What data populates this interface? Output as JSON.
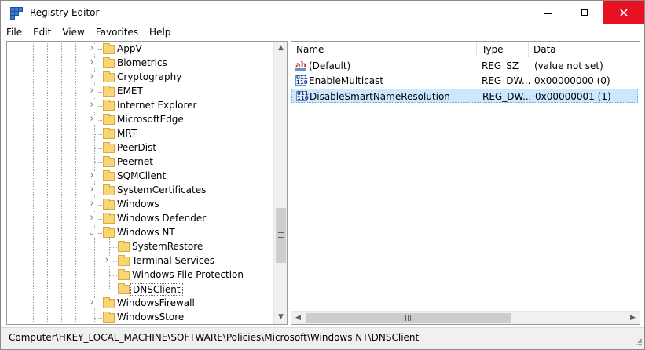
{
  "window": {
    "title": "Registry Editor",
    "close_glyph": "✕"
  },
  "menu": [
    "File",
    "Edit",
    "View",
    "Favorites",
    "Help"
  ],
  "tree": {
    "items": [
      {
        "label": "AppV",
        "level": 0,
        "expandable": true,
        "selected": false
      },
      {
        "label": "Biometrics",
        "level": 0,
        "expandable": true,
        "selected": false
      },
      {
        "label": "Cryptography",
        "level": 0,
        "expandable": true,
        "selected": false
      },
      {
        "label": "EMET",
        "level": 0,
        "expandable": true,
        "selected": false
      },
      {
        "label": "Internet Explorer",
        "level": 0,
        "expandable": true,
        "selected": false
      },
      {
        "label": "MicrosoftEdge",
        "level": 0,
        "expandable": true,
        "selected": false
      },
      {
        "label": "MRT",
        "level": 0,
        "expandable": false,
        "selected": false
      },
      {
        "label": "PeerDist",
        "level": 0,
        "expandable": false,
        "selected": false
      },
      {
        "label": "Peernet",
        "level": 0,
        "expandable": false,
        "selected": false
      },
      {
        "label": "SQMClient",
        "level": 0,
        "expandable": true,
        "selected": false
      },
      {
        "label": "SystemCertificates",
        "level": 0,
        "expandable": true,
        "selected": false
      },
      {
        "label": "Windows",
        "level": 0,
        "expandable": true,
        "selected": false
      },
      {
        "label": "Windows Defender",
        "level": 0,
        "expandable": true,
        "selected": false
      },
      {
        "label": "Windows NT",
        "level": 0,
        "expandable": true,
        "expanded": true,
        "selected": false
      },
      {
        "label": "SystemRestore",
        "level": 1,
        "expandable": false,
        "selected": false
      },
      {
        "label": "Terminal Services",
        "level": 1,
        "expandable": true,
        "selected": false
      },
      {
        "label": "Windows File Protection",
        "level": 1,
        "expandable": false,
        "selected": false
      },
      {
        "label": "DNSClient",
        "level": 1,
        "expandable": false,
        "selected": true
      },
      {
        "label": "WindowsFirewall",
        "level": 0,
        "expandable": true,
        "selected": false
      },
      {
        "label": "WindowsStore",
        "level": 0,
        "expandable": false,
        "selected": false
      }
    ]
  },
  "list": {
    "columns": [
      "Name",
      "Type",
      "Data"
    ],
    "rows": [
      {
        "icon": "string-value-icon",
        "icon_text": "ab",
        "name": "(Default)",
        "type": "REG_SZ",
        "data": "(value not set)",
        "selected": false
      },
      {
        "icon": "binary-value-icon",
        "icon_text": "011 110",
        "name": "EnableMulticast",
        "type": "REG_DW...",
        "data": "0x00000000 (0)",
        "selected": false
      },
      {
        "icon": "binary-value-icon",
        "icon_text": "011 110",
        "name": "DisableSmartNameResolution",
        "type": "REG_DW...",
        "data": "0x00000001 (1)",
        "selected": true
      }
    ]
  },
  "statusbar": {
    "path": "Computer\\HKEY_LOCAL_MACHINE\\SOFTWARE\\Policies\\Microsoft\\Windows NT\\DNSClient"
  },
  "colors": {
    "close_button": "#e81123",
    "selection": "#cce8ff",
    "folder": "#f8d575"
  }
}
